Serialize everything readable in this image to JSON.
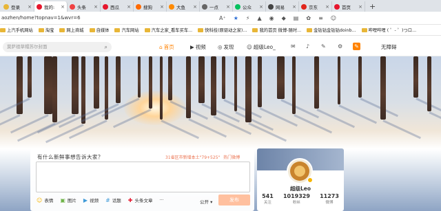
{
  "browser": {
    "tabs": [
      {
        "label": "登录",
        "color": "#e8b637",
        "active": false
      },
      {
        "label": "我的:",
        "color": "#e6162d",
        "active": true
      },
      {
        "label": "头条",
        "color": "#f04142",
        "active": false
      },
      {
        "label": "西瓜",
        "color": "#e6162d",
        "active": false
      },
      {
        "label": "搜狗",
        "color": "#ff6a00",
        "active": false
      },
      {
        "label": "大鱼",
        "color": "#ff8a00",
        "active": false
      },
      {
        "label": "一点",
        "color": "#666666",
        "active": false
      },
      {
        "label": "公众",
        "color": "#07c160",
        "active": false
      },
      {
        "label": "网易",
        "color": "#444444",
        "active": false
      },
      {
        "label": "京东",
        "color": "#e1251b",
        "active": false
      },
      {
        "label": "首页",
        "color": "#e6162d",
        "active": false
      }
    ],
    "new_tab": "+",
    "url": "aozhen/home?topnav=1&wvr=6",
    "addr_icons": [
      "A⁺",
      "★",
      "⚡",
      "▲",
      "◉",
      "◆",
      "▤",
      "✿",
      "≡",
      "☺"
    ],
    "bookmarks": [
      "上汽手机网站",
      "淘宝",
      "网上商城",
      "自媒体",
      "汽车网站",
      "汽车之家_看车买车...",
      "快科技(原驱动之家)...",
      "我的首页 微博-随时...",
      "金钴钴金钴钴doinb...",
      "哔哩哔哩 ( ゜- ゜)つロ..."
    ]
  },
  "weibo_nav": {
    "search_placeholder": "莫萨祖草帽苏尔封面",
    "home": "首页",
    "video": "视频",
    "discover": "发现",
    "username": "超级Leo_",
    "no_barrier": "无障碍"
  },
  "composer": {
    "title": "有什么新鲜事想告诉大家？",
    "hot_text": "31省区市新增本土\"79+525\"",
    "hot_link": "热门微博",
    "tools": [
      "表情",
      "图片",
      "视频",
      "话题",
      "头条文章"
    ],
    "more": "···",
    "visibility": "公开",
    "send": "发布"
  },
  "profile": {
    "name": "超级Leo",
    "stats": [
      {
        "value": "541",
        "label": "关注"
      },
      {
        "value": "1019329",
        "label": "粉丝"
      },
      {
        "value": "11273",
        "label": "微博"
      }
    ]
  }
}
